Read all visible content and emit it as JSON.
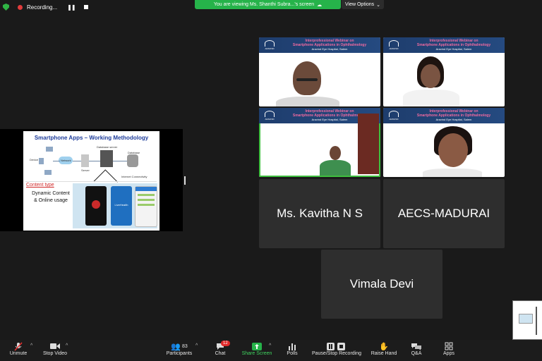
{
  "top": {
    "recording_label": "Recording...",
    "view_banner": "You are viewing Ms. Shanthi Subra...'s screen",
    "view_options": "View Options"
  },
  "slide": {
    "title": "Smartphone  Apps – Working Methodology",
    "content_type": "Content type",
    "dynamic_line1": "Dynamic Content",
    "dynamic_line2": "& Online usage",
    "labels": [
      "Database server",
      "Database",
      "Internet Connectivity",
      "Network",
      "Server",
      "Device"
    ],
    "app_name": "LiveHealth"
  },
  "banner": {
    "line1": "Interprofessional Webinar on",
    "line2": "Smartphone Applications in Ophthalmology",
    "line3": "Aravind Eye Hospital, Salem",
    "logo_text": "ARAVIND"
  },
  "name_tiles": {
    "kavitha": "Ms. Kavitha N S",
    "madurai": "AECS-MADURAI",
    "vimala": "Vimala Devi"
  },
  "toolbar": {
    "unmute": "Unmute",
    "stop_video": "Stop Video",
    "participants": "Participants",
    "participants_count": "83",
    "chat": "Chat",
    "chat_badge": "12",
    "share_screen": "Share Screen",
    "polls": "Polls",
    "recording": "Pause/Stop Recording",
    "raise_hand": "Raise Hand",
    "qa": "Q&A",
    "apps": "Apps"
  },
  "colors": {
    "share_green": "#26b34a",
    "banner_navy": "#1e3d6d",
    "banner_pink": "#f06aa0",
    "active_speaker": "#3fbf3f"
  }
}
